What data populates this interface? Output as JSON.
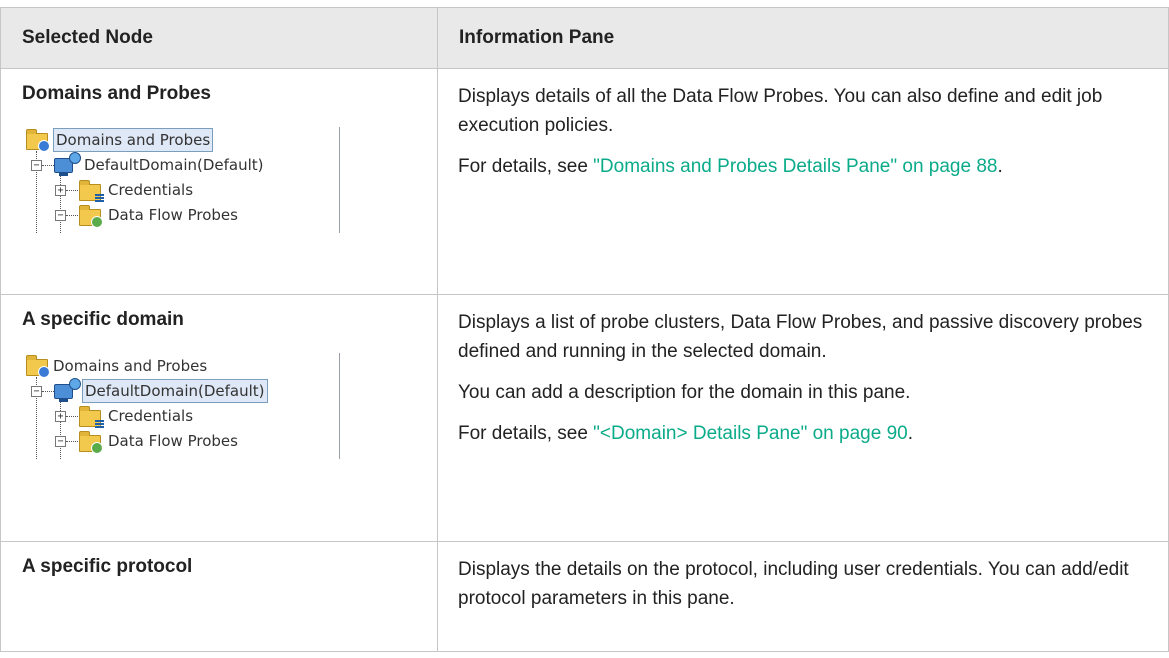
{
  "table": {
    "headers": [
      "Selected Node",
      "Information Pane"
    ],
    "rows": [
      {
        "node": "Domains and Probes",
        "tree": {
          "root": "Domains and Probes",
          "domain": "DefaultDomain(Default)",
          "credentials": "Credentials",
          "probes": "Data Flow Probes",
          "selected": "root"
        },
        "paragraphs": [
          {
            "text": "Displays details of all the Data Flow Probes. You can also define and edit job execution policies."
          },
          {
            "prefix": "For details, see ",
            "link": "\"Domains and Probes Details Pane\" on page 88",
            "suffix": "."
          }
        ]
      },
      {
        "node": "A specific domain",
        "tree": {
          "root": "Domains and Probes",
          "domain": "DefaultDomain(Default)",
          "credentials": "Credentials",
          "probes": "Data Flow Probes",
          "selected": "domain"
        },
        "paragraphs": [
          {
            "text": "Displays a list of probe clusters, Data Flow Probes, and passive discovery probes defined and running in the selected domain."
          },
          {
            "text": "You can add a description for the domain in this pane."
          },
          {
            "prefix": "For details, see ",
            "link": "\"<Domain> Details Pane\" on page 90",
            "suffix": "."
          }
        ]
      },
      {
        "node": "A specific protocol",
        "paragraphs": [
          {
            "text": "Displays the details on the protocol, including user credentials. You can add/edit protocol parameters in this pane."
          }
        ]
      }
    ]
  },
  "colors": {
    "link": "#0bab8a",
    "header_bg": "#e9e9e9",
    "border": "#c6c6c6",
    "selection_bg": "#dfe8f6"
  },
  "icons": [
    "folder-icon",
    "computer-globe-icon",
    "credentials-folder-icon",
    "probes-folder-icon",
    "expand-icon",
    "collapse-icon"
  ]
}
